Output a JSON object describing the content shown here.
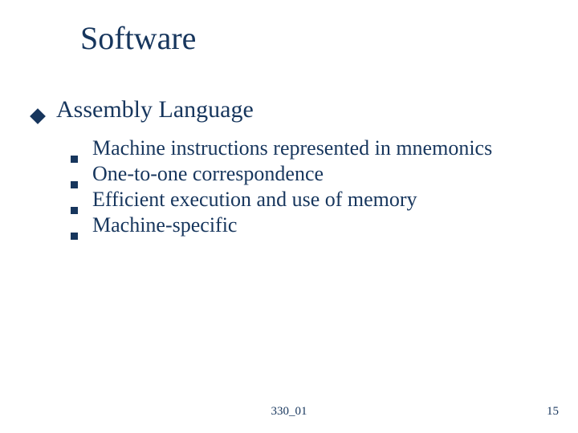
{
  "title": "Software",
  "topic": {
    "label": "Assembly Language"
  },
  "subpoints": [
    {
      "text": "Machine instructions represented in mnemonics"
    },
    {
      "text": "One-to-one correspondence"
    },
    {
      "text": "Efficient execution and use of memory"
    },
    {
      "text": "Machine-specific"
    }
  ],
  "footer": {
    "center": "330_01",
    "page": "15"
  }
}
